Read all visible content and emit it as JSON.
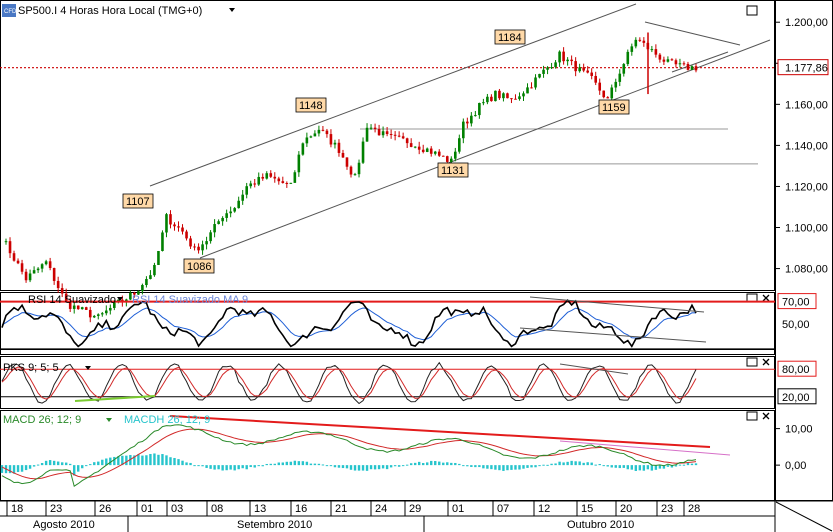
{
  "header": {
    "symbol_badge": "CFD",
    "title": "SP500.I 4 Horas Hora Local (TMG+0)"
  },
  "colors": {
    "up": "#008000",
    "down": "#cc0000",
    "price_line": "#cc0000",
    "rsi": "#000000",
    "rsi_ma": "#1f5fd6",
    "stoch_k": "#222222",
    "stoch_d": "#d22a2a",
    "macd": "#2a8a2a",
    "macd_signal": "#d22a2a",
    "macdh": "#26c4cc",
    "trend_red": "#e31b1b",
    "trend_pink": "#d670c8",
    "trend_green": "#7acb30",
    "label_bg": "#ffd9a8",
    "channel": "#555555"
  },
  "chart_data": [
    {
      "panel": "price",
      "type": "candlestick",
      "y_ticks": [
        "1.080,00",
        "1.100,00",
        "1.120,00",
        "1.140,00",
        "1.160,00",
        "1.180,00",
        "1.200,00"
      ],
      "ylim": [
        1072,
        1204
      ],
      "current_price_label": "1.177,86",
      "current_price": 1177.86,
      "annotations": [
        {
          "text": "1107",
          "value": 1107
        },
        {
          "text": "1086",
          "value": 1086
        },
        {
          "text": "1148",
          "value": 1148
        },
        {
          "text": "1131",
          "value": 1131
        },
        {
          "text": "1184",
          "value": 1184
        },
        {
          "text": "1159",
          "value": 1159
        }
      ],
      "horizontal_levels": [
        1148,
        1131
      ]
    },
    {
      "panel": "rsi",
      "type": "line",
      "legend": [
        "RSI 14 Suavizado",
        "RSI 14 Suavizado MA 9"
      ],
      "y_ticks": [
        "70,00",
        "50,00"
      ],
      "levels": [
        70,
        30
      ],
      "ylim": [
        25,
        75
      ]
    },
    {
      "panel": "stochastic",
      "type": "line",
      "legend": [
        "PKS 9; 5; 5"
      ],
      "y_ticks": [
        "80,00",
        "20,00"
      ],
      "levels": [
        80,
        20
      ],
      "ylim": [
        0,
        100
      ]
    },
    {
      "panel": "macd",
      "type": "line",
      "legend": [
        "MACD 26; 12; 9",
        "MACDH 26; 12; 9"
      ],
      "y_ticks": [
        "10,00",
        "0,00"
      ],
      "ylim": [
        -9,
        14
      ]
    }
  ],
  "x_axis": {
    "days": [
      "18",
      "23",
      "26",
      "01",
      "03",
      "08",
      "13",
      "16",
      "21",
      "24",
      "29",
      "01",
      "07",
      "12",
      "15",
      "20",
      "23",
      "28"
    ],
    "months": [
      "Agosto 2010",
      "Setembro 2010",
      "Outubro 2010"
    ]
  }
}
